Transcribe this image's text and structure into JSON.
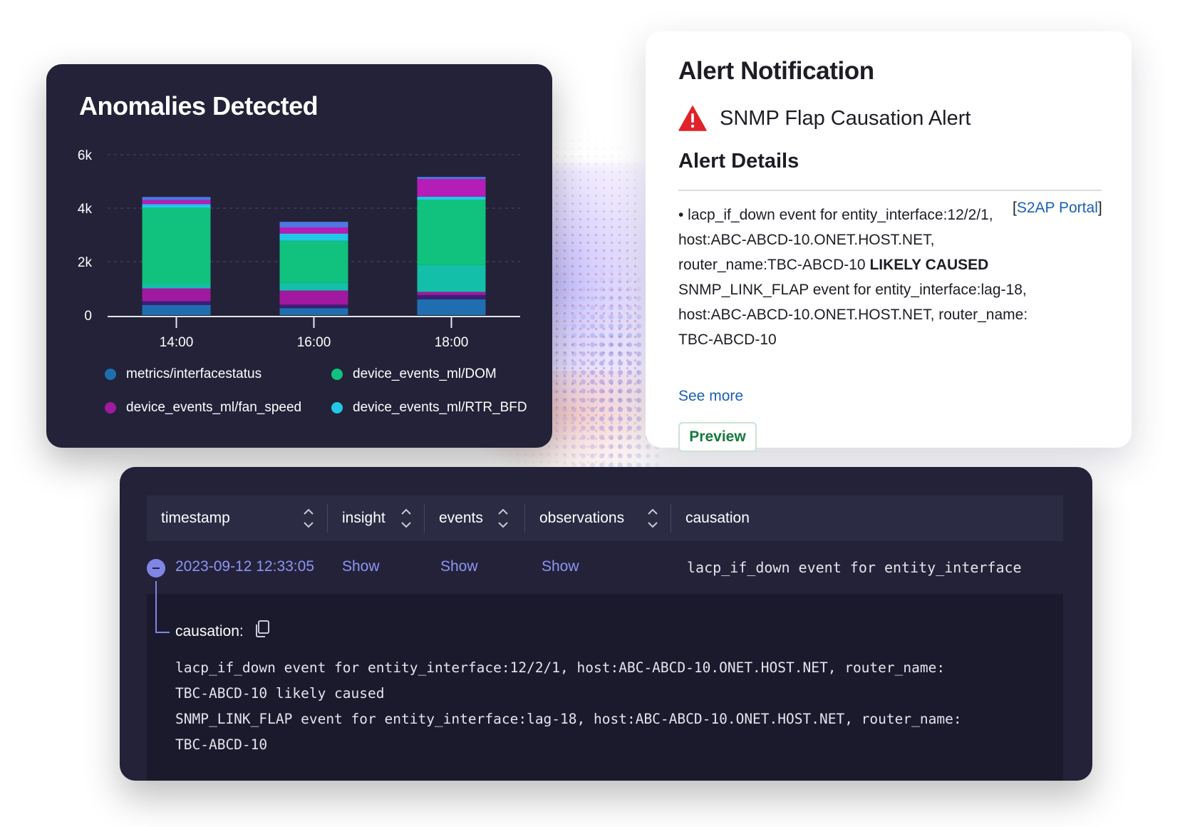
{
  "chart_card": {
    "title": "Anomalies Detected",
    "chart_data": {
      "type": "bar",
      "stacked": true,
      "categories": [
        "14:00",
        "16:00",
        "18:00"
      ],
      "y_ticks": [
        "6k",
        "4k",
        "2k",
        "0"
      ],
      "ylim": [
        0,
        6000
      ],
      "grid": true,
      "segments": [
        [
          {
            "value": 380,
            "color": "#1f6fb0"
          },
          {
            "value": 140,
            "color": "#3a1f75"
          },
          {
            "value": 480,
            "color": "#a0199f"
          },
          {
            "value": 160,
            "color": "#13bfa8"
          },
          {
            "value": 2850,
            "color": "#10c27d"
          },
          {
            "value": 140,
            "color": "#22c8e6"
          },
          {
            "value": 150,
            "color": "#b51db6"
          },
          {
            "value": 120,
            "color": "#4e77e0"
          }
        ],
        [
          {
            "value": 260,
            "color": "#1f6fb0"
          },
          {
            "value": 130,
            "color": "#3a1f75"
          },
          {
            "value": 530,
            "color": "#a0199f"
          },
          {
            "value": 290,
            "color": "#13bfa8"
          },
          {
            "value": 1570,
            "color": "#10c27d"
          },
          {
            "value": 270,
            "color": "#22c8e6"
          },
          {
            "value": 230,
            "color": "#b51db6"
          },
          {
            "value": 210,
            "color": "#4e77e0"
          }
        ],
        [
          {
            "value": 590,
            "color": "#1f6fb0"
          },
          {
            "value": 160,
            "color": "#3a1f75"
          },
          {
            "value": 120,
            "color": "#a0199f"
          },
          {
            "value": 1000,
            "color": "#13bfa8"
          },
          {
            "value": 2450,
            "color": "#10c27d"
          },
          {
            "value": 110,
            "color": "#22c8e6"
          },
          {
            "value": 660,
            "color": "#b51db6"
          },
          {
            "value": 80,
            "color": "#4e77e0"
          }
        ]
      ],
      "legend": [
        {
          "label": "metrics/interfacestatus",
          "color": "#1f6fb0"
        },
        {
          "label": "device_events_ml/DOM",
          "color": "#10c27d"
        },
        {
          "label": "device_events_ml/fan_speed",
          "color": "#a0199f"
        },
        {
          "label": "device_events_ml/RTR_BFD",
          "color": "#22c8e6"
        }
      ]
    }
  },
  "alert_card": {
    "title": "Alert Notification",
    "alert_icon": "warning-triangle-icon",
    "alert_name": "SNMP Flap Causation Alert",
    "details_title": "Alert Details",
    "details_lines": {
      "l1": "• lacp_if_down event for entity_interface:12/2/1,",
      "l2": "host:ABC-ABCD-10.ONET.HOST.NET,",
      "l3_pre": "router_name:TBC-ABCD-10 ",
      "l3_bold": "LIKELY CAUSED",
      "l4": "SNMP_LINK_FLAP event for entity_interface:lag-18,",
      "l5": "host:ABC-ABCD-10.ONET.HOST.NET, router_name:",
      "l6": "TBC-ABCD-10"
    },
    "portal_open": "[",
    "portal_link": "S2AP Portal",
    "portal_close": "]",
    "see_more": "See more",
    "preview_button": "Preview",
    "colors": {
      "warning": "#e0222a",
      "link": "#1a5fb4",
      "preview": "#147a3e"
    }
  },
  "table_card": {
    "columns": [
      {
        "label": "timestamp",
        "sortable": true
      },
      {
        "label": "insight",
        "sortable": true
      },
      {
        "label": "events",
        "sortable": true
      },
      {
        "label": "observations",
        "sortable": true
      },
      {
        "label": "causation",
        "sortable": false
      }
    ],
    "row": {
      "timestamp": "2023-09-12 12:33:05",
      "insight": "Show",
      "events": "Show",
      "observations": "Show",
      "causation": "lacp_if_down event for entity_interface"
    },
    "expanded": {
      "label": "causation:",
      "copy_icon": "copy-icon",
      "lines": [
        "lacp_if_down event for entity_interface:12/2/1, host:ABC-ABCD-10.ONET.HOST.NET, router_name:",
        "TBC-ABCD-10 likely caused",
        "SNMP_LINK_FLAP event for entity_interface:lag-18, host:ABC-ABCD-10.ONET.HOST.NET, router_name:",
        "TBC-ABCD-10"
      ]
    }
  }
}
